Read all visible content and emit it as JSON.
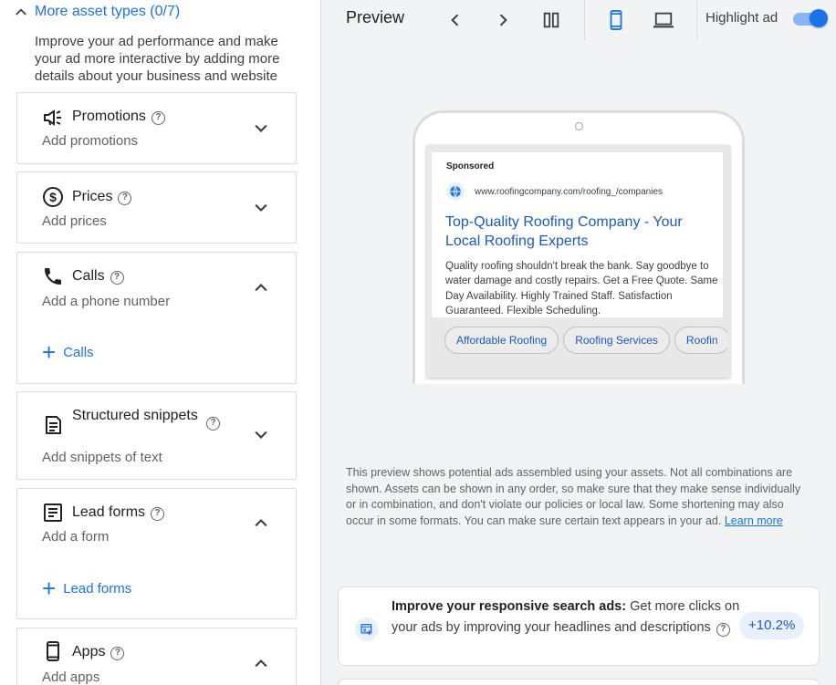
{
  "left_panel": {
    "section_header": "More asset types (0/7)",
    "intro": "Improve your ad performance and make your ad more interactive by adding more details about your business and website",
    "assets": [
      {
        "title": "Promotions",
        "subtitle": "Add promotions",
        "icon": "megaphone-icon",
        "expanded": false
      },
      {
        "title": "Prices",
        "subtitle": "Add prices",
        "icon": "dollar-circle-icon",
        "expanded": false
      },
      {
        "title": "Calls",
        "subtitle": "Add a phone number",
        "icon": "phone-icon",
        "expanded": true,
        "add_label": "Calls"
      },
      {
        "title": "Structured snippets",
        "subtitle": "Add snippets of text",
        "icon": "document-icon",
        "expanded": false
      },
      {
        "title": "Lead forms",
        "subtitle": "Add a form",
        "icon": "form-icon",
        "expanded": true,
        "add_label": "Lead forms"
      },
      {
        "title": "Apps",
        "subtitle": "Add apps",
        "icon": "mobile-app-icon",
        "expanded": true
      }
    ],
    "help_glyph": "?"
  },
  "preview": {
    "title": "Preview",
    "highlight_label": "Highlight ad",
    "highlight_on": true,
    "device_selected": "mobile",
    "ad": {
      "sponsored": "Sponsored",
      "url": "www.roofingcompany.com/roofing_/companies",
      "headline": "Top-Quality Roofing Company - Your Local Roofing Experts",
      "description": "Quality roofing shouldn't break the bank. Say goodbye to water damage and costly repairs. Get a Free Quote. Same Day Availability. Highly Trained Staff. Satisfaction Guaranteed. Flexible Scheduling.",
      "sitelinks": [
        "Affordable Roofing",
        "Roofing Services",
        "Roofin"
      ]
    },
    "disclaimer": "This preview shows potential ads assembled using your assets. Not all combinations are shown. Assets can be shown in any order, so make sure that they make sense individually or in combination, and don't violate our policies or local law. Some shortening may also occur in some formats. You can make sure certain text appears in your ad.",
    "learn_more": "Learn more"
  },
  "tip": {
    "bold": "Improve your responsive search ads:",
    "text": " Get more clicks on your ads by improving your headlines and descriptions",
    "badge": "+10.2%"
  },
  "colors": {
    "accent": "#1a73e8",
    "ad_link": "#1a5bbf",
    "panel_bg": "#f1f3f4"
  }
}
